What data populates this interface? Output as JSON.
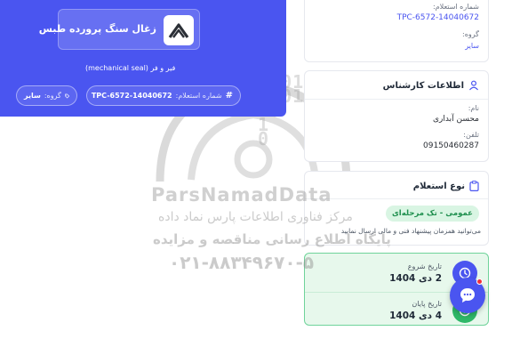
{
  "header": {
    "company_name": "زغال سنگ پرورده طبس",
    "item_title": "فیر و فر (mechanical seal)",
    "inquiry_label": "شماره استعلام:",
    "inquiry_number": "TPC-6572-14040672",
    "group_label": "گروه:",
    "group_value": "سایر"
  },
  "info_card": {
    "inquiry_label": "شماره استعلام:",
    "inquiry_number": "TPC-6572-14040672",
    "group_label": "گروه:",
    "group_value": "سایر"
  },
  "expert": {
    "title": "اطلاعات کارشناس",
    "name_label": "نام:",
    "name_value": "محسن آبداری",
    "phone_label": "تلفن:",
    "phone_value": "09150460287"
  },
  "inquiry_type": {
    "title": "نوع استعلام",
    "badge": "عمومی - تک مرحله‌ای",
    "description": "می‌توانید همزمان پیشنهاد فنی و مالی ارسال نمایید"
  },
  "dates": {
    "start_label": "تاریخ شروع",
    "start_value": "2 دی 1404",
    "end_label": "تاریخ پایان",
    "end_value": "4 دی 1404"
  },
  "watermark": {
    "binary": "010101\n0001\n10\n1\n0",
    "brand": "ParsNamadData",
    "line1": "مرکز فناوری اطلاعات پارس نماد داده",
    "line2": "پایگاه اطلاع رسانی مناقصه و مزایده",
    "line3": "۰۲۱-۸۸۳۴۹۶۷۰-۵"
  },
  "colors": {
    "primary": "#4a55f0",
    "success": "#2fb868",
    "success_bg": "#e7f8ec",
    "badge_text": "#1f8f4e",
    "notification": "#f0303b"
  },
  "icons": [
    "company-logo-icon",
    "hash-icon",
    "tag-icon",
    "user-icon",
    "clipboard-icon",
    "clock-icon",
    "check-circle-icon",
    "chat-icon"
  ]
}
